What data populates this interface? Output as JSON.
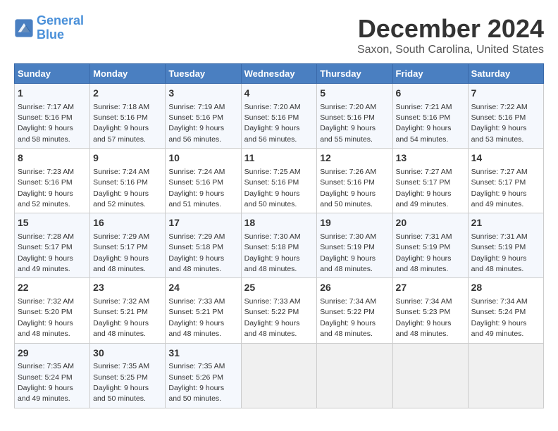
{
  "logo": {
    "line1": "General",
    "line2": "Blue"
  },
  "header": {
    "month": "December 2024",
    "location": "Saxon, South Carolina, United States"
  },
  "weekdays": [
    "Sunday",
    "Monday",
    "Tuesday",
    "Wednesday",
    "Thursday",
    "Friday",
    "Saturday"
  ],
  "weeks": [
    [
      {
        "day": 1,
        "sunrise": "7:17 AM",
        "sunset": "5:16 PM",
        "daylight": "9 hours and 58 minutes."
      },
      {
        "day": 2,
        "sunrise": "7:18 AM",
        "sunset": "5:16 PM",
        "daylight": "9 hours and 57 minutes."
      },
      {
        "day": 3,
        "sunrise": "7:19 AM",
        "sunset": "5:16 PM",
        "daylight": "9 hours and 56 minutes."
      },
      {
        "day": 4,
        "sunrise": "7:20 AM",
        "sunset": "5:16 PM",
        "daylight": "9 hours and 56 minutes."
      },
      {
        "day": 5,
        "sunrise": "7:20 AM",
        "sunset": "5:16 PM",
        "daylight": "9 hours and 55 minutes."
      },
      {
        "day": 6,
        "sunrise": "7:21 AM",
        "sunset": "5:16 PM",
        "daylight": "9 hours and 54 minutes."
      },
      {
        "day": 7,
        "sunrise": "7:22 AM",
        "sunset": "5:16 PM",
        "daylight": "9 hours and 53 minutes."
      }
    ],
    [
      {
        "day": 8,
        "sunrise": "7:23 AM",
        "sunset": "5:16 PM",
        "daylight": "9 hours and 52 minutes."
      },
      {
        "day": 9,
        "sunrise": "7:24 AM",
        "sunset": "5:16 PM",
        "daylight": "9 hours and 52 minutes."
      },
      {
        "day": 10,
        "sunrise": "7:24 AM",
        "sunset": "5:16 PM",
        "daylight": "9 hours and 51 minutes."
      },
      {
        "day": 11,
        "sunrise": "7:25 AM",
        "sunset": "5:16 PM",
        "daylight": "9 hours and 50 minutes."
      },
      {
        "day": 12,
        "sunrise": "7:26 AM",
        "sunset": "5:16 PM",
        "daylight": "9 hours and 50 minutes."
      },
      {
        "day": 13,
        "sunrise": "7:27 AM",
        "sunset": "5:17 PM",
        "daylight": "9 hours and 49 minutes."
      },
      {
        "day": 14,
        "sunrise": "7:27 AM",
        "sunset": "5:17 PM",
        "daylight": "9 hours and 49 minutes."
      }
    ],
    [
      {
        "day": 15,
        "sunrise": "7:28 AM",
        "sunset": "5:17 PM",
        "daylight": "9 hours and 49 minutes."
      },
      {
        "day": 16,
        "sunrise": "7:29 AM",
        "sunset": "5:17 PM",
        "daylight": "9 hours and 48 minutes."
      },
      {
        "day": 17,
        "sunrise": "7:29 AM",
        "sunset": "5:18 PM",
        "daylight": "9 hours and 48 minutes."
      },
      {
        "day": 18,
        "sunrise": "7:30 AM",
        "sunset": "5:18 PM",
        "daylight": "9 hours and 48 minutes."
      },
      {
        "day": 19,
        "sunrise": "7:30 AM",
        "sunset": "5:19 PM",
        "daylight": "9 hours and 48 minutes."
      },
      {
        "day": 20,
        "sunrise": "7:31 AM",
        "sunset": "5:19 PM",
        "daylight": "9 hours and 48 minutes."
      },
      {
        "day": 21,
        "sunrise": "7:31 AM",
        "sunset": "5:19 PM",
        "daylight": "9 hours and 48 minutes."
      }
    ],
    [
      {
        "day": 22,
        "sunrise": "7:32 AM",
        "sunset": "5:20 PM",
        "daylight": "9 hours and 48 minutes."
      },
      {
        "day": 23,
        "sunrise": "7:32 AM",
        "sunset": "5:21 PM",
        "daylight": "9 hours and 48 minutes."
      },
      {
        "day": 24,
        "sunrise": "7:33 AM",
        "sunset": "5:21 PM",
        "daylight": "9 hours and 48 minutes."
      },
      {
        "day": 25,
        "sunrise": "7:33 AM",
        "sunset": "5:22 PM",
        "daylight": "9 hours and 48 minutes."
      },
      {
        "day": 26,
        "sunrise": "7:34 AM",
        "sunset": "5:22 PM",
        "daylight": "9 hours and 48 minutes."
      },
      {
        "day": 27,
        "sunrise": "7:34 AM",
        "sunset": "5:23 PM",
        "daylight": "9 hours and 48 minutes."
      },
      {
        "day": 28,
        "sunrise": "7:34 AM",
        "sunset": "5:24 PM",
        "daylight": "9 hours and 49 minutes."
      }
    ],
    [
      {
        "day": 29,
        "sunrise": "7:35 AM",
        "sunset": "5:24 PM",
        "daylight": "9 hours and 49 minutes."
      },
      {
        "day": 30,
        "sunrise": "7:35 AM",
        "sunset": "5:25 PM",
        "daylight": "9 hours and 50 minutes."
      },
      {
        "day": 31,
        "sunrise": "7:35 AM",
        "sunset": "5:26 PM",
        "daylight": "9 hours and 50 minutes."
      },
      null,
      null,
      null,
      null
    ]
  ]
}
